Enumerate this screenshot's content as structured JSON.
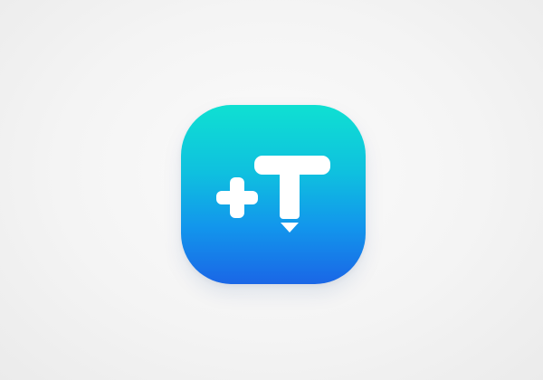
{
  "app_icon": {
    "name": "text-add-app",
    "glyphs": [
      "plus-icon",
      "text-cursor-t-icon"
    ],
    "colors": {
      "gradient_top": "#0fe0d2",
      "gradient_bottom": "#1a66e6",
      "glyph": "#ffffff",
      "background": "#f4f4f4"
    }
  }
}
